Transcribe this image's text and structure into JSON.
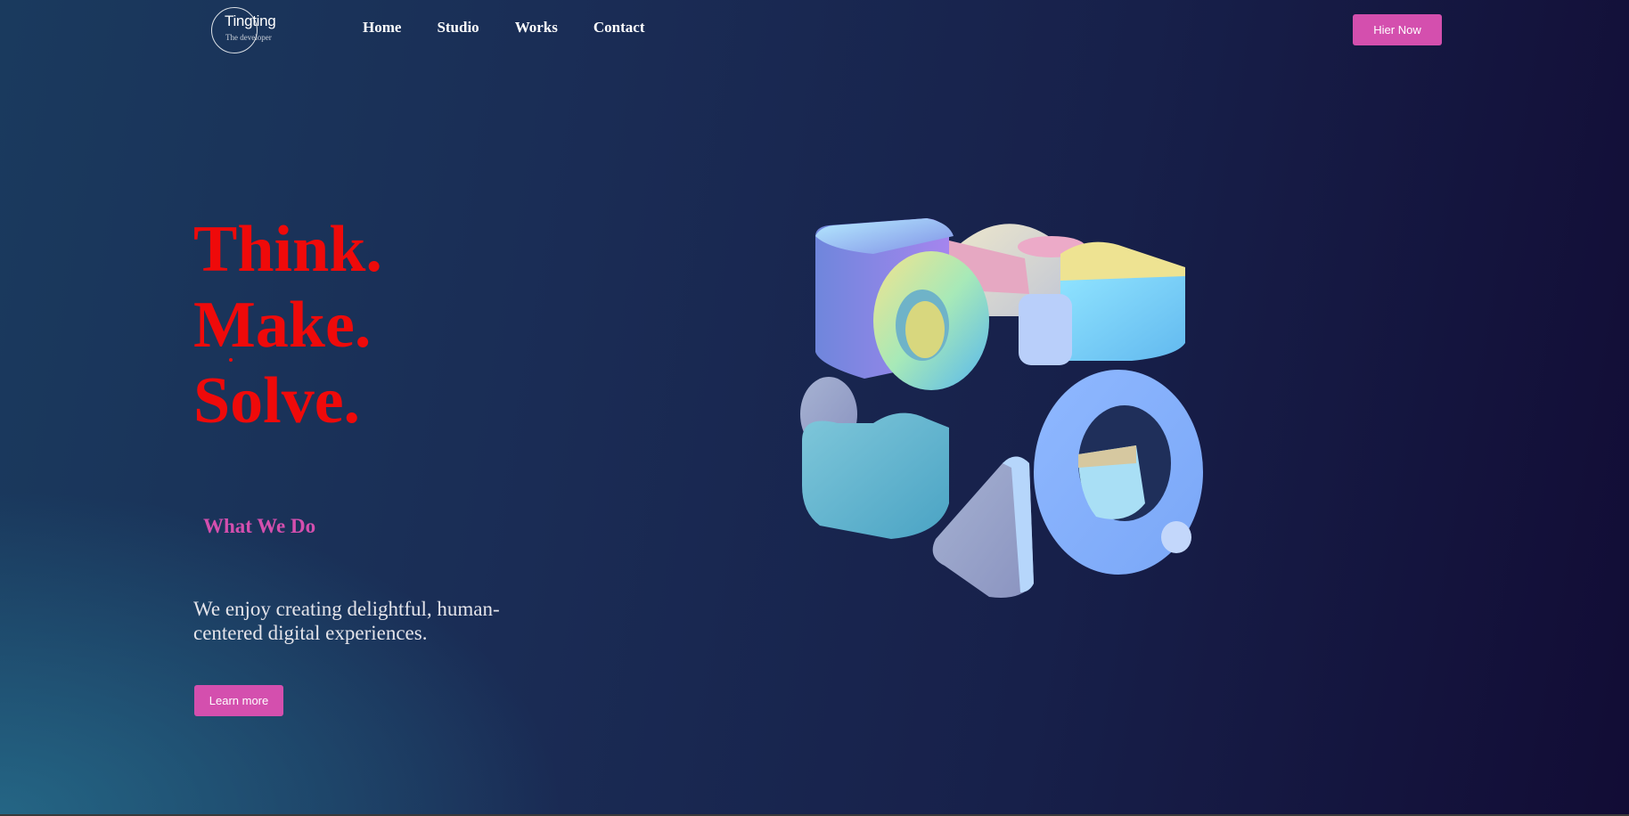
{
  "header": {
    "logo": {
      "name": "Tingting",
      "tagline": "The developer"
    },
    "nav": [
      {
        "label": "Home"
      },
      {
        "label": "Studio"
      },
      {
        "label": "Works"
      },
      {
        "label": "Contact"
      }
    ],
    "cta_label": "Hier Now"
  },
  "hero": {
    "headline": [
      "Think.",
      "Make.",
      "Solve."
    ],
    "section_label": "What We Do",
    "description": "We enjoy creating delightful, human-centered digital experiences.",
    "button_label": "Learn more",
    "art": {
      "icon": "abstract-3d-shapes"
    }
  },
  "colors": {
    "accent": "#d44fae",
    "headline": "#ef0a0a",
    "bg_left": "#1a3a5e",
    "bg_right": "#120c35"
  }
}
